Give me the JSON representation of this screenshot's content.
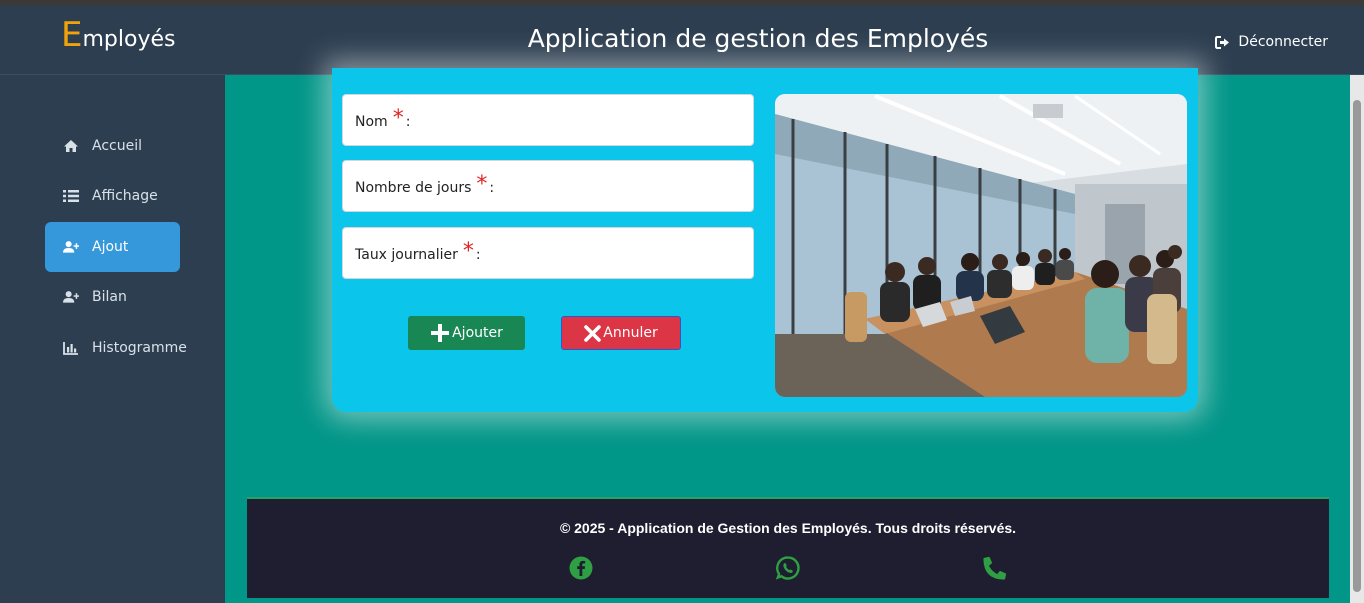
{
  "header": {
    "logo_initial": "E",
    "logo_rest": "mployés",
    "title": "Application de gestion des Employés",
    "logout_label": "Déconnecter"
  },
  "sidebar": {
    "items": [
      {
        "label": "Accueil",
        "icon": "home-icon"
      },
      {
        "label": "Affichage",
        "icon": "list-icon"
      },
      {
        "label": "Ajout",
        "icon": "user-plus-icon",
        "active": true
      },
      {
        "label": "Bilan",
        "icon": "user-plus-icon"
      },
      {
        "label": "Histogramme",
        "icon": "bar-chart-icon"
      }
    ]
  },
  "form": {
    "fields": [
      {
        "label": "Nom",
        "suffix": " :",
        "required_mark": "*",
        "value": ""
      },
      {
        "label": "Nombre de jours",
        "suffix": ":",
        "required_mark": "*",
        "value": ""
      },
      {
        "label": "Taux journalier",
        "suffix": ":",
        "required_mark": "*",
        "value": ""
      }
    ],
    "add_label": "Ajouter",
    "cancel_label": "Annuler"
  },
  "footer": {
    "copyright": "© 2025 - Application de Gestion des Employés. Tous droits réservés.",
    "social": [
      "facebook-icon",
      "whatsapp-icon",
      "phone-icon"
    ]
  },
  "colors": {
    "page_bg": "#009688",
    "sidebar_bg": "#2c3e50",
    "active_nav": "#3498db",
    "card_bg": "#0bc5ea",
    "add_button": "#198754",
    "cancel_button": "#dc3545",
    "logo_accent": "#f0a30a",
    "social_icons": "#2ea043"
  }
}
